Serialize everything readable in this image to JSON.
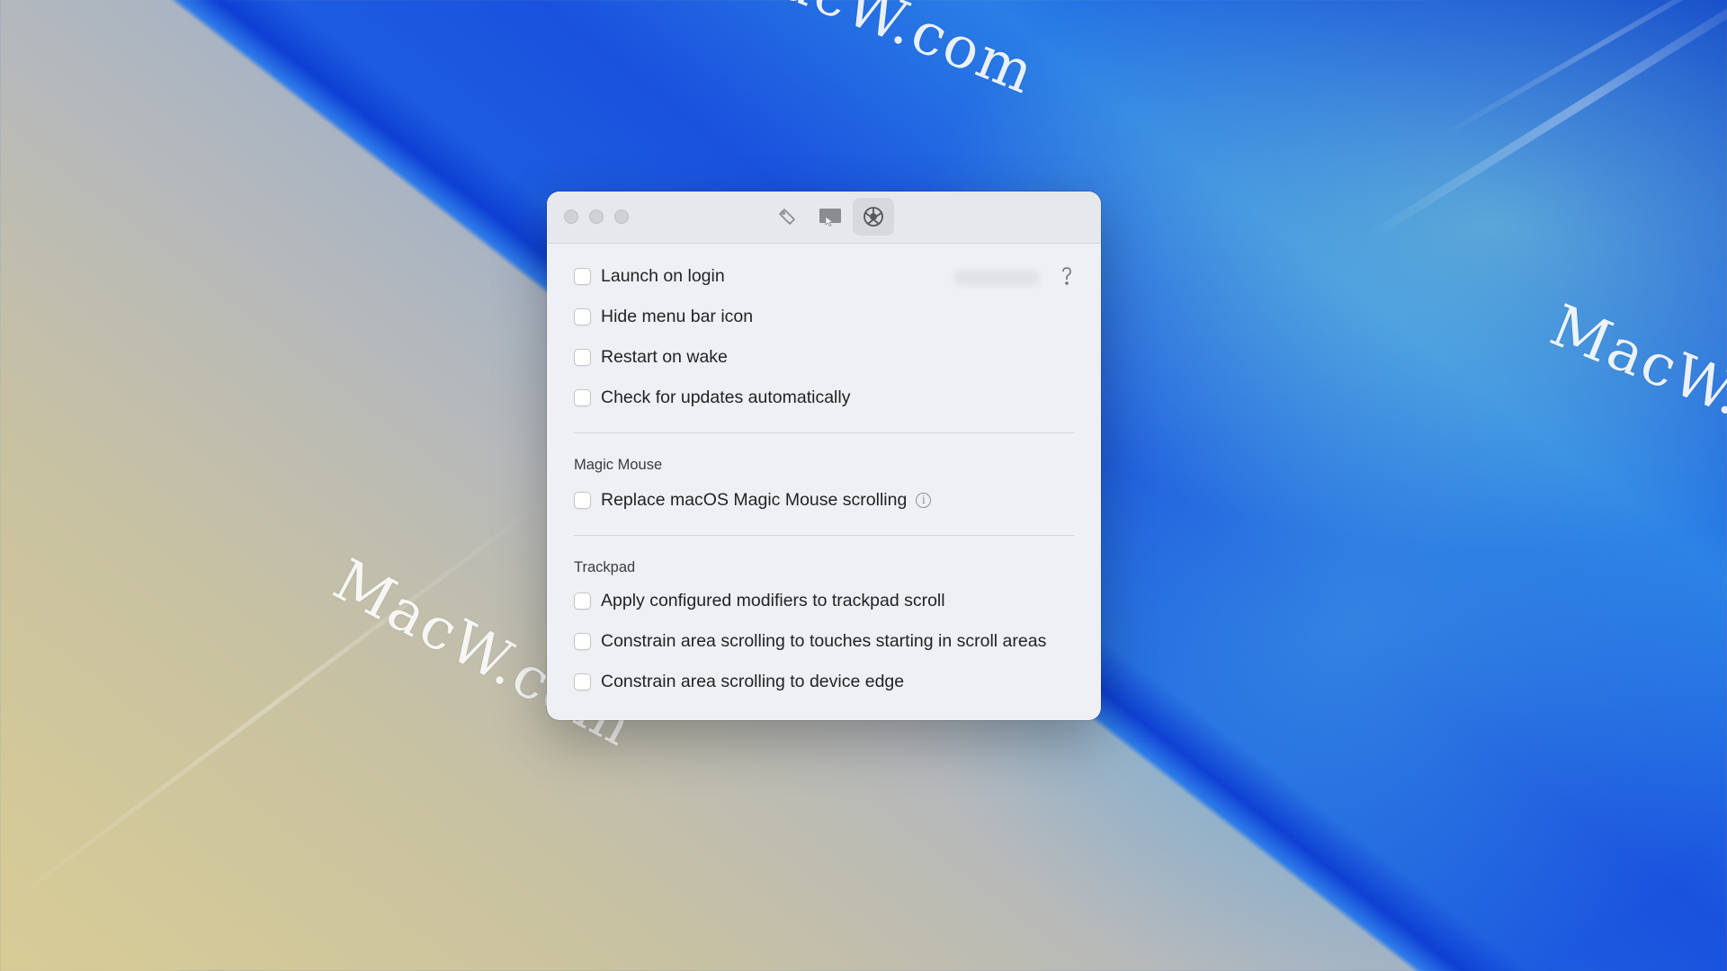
{
  "desktop": {
    "watermarks": [
      "MacW.com",
      "MacW.com",
      "MacW.c"
    ]
  },
  "window": {
    "toolbar": [
      {
        "icon": "tag-icon",
        "active": false
      },
      {
        "icon": "display-icon",
        "active": false
      },
      {
        "icon": "gear-icon",
        "active": true
      }
    ],
    "general": [
      {
        "label": "Launch on login",
        "checked": false
      },
      {
        "label": "Hide menu bar icon",
        "checked": false
      },
      {
        "label": "Restart on wake",
        "checked": false
      },
      {
        "label": "Check for updates automatically",
        "checked": false
      }
    ],
    "magic_mouse": {
      "title": "Magic Mouse",
      "items": [
        {
          "label": "Replace macOS Magic Mouse scrolling",
          "checked": false,
          "info_icon": "info-icon"
        }
      ]
    },
    "trackpad": {
      "title": "Trackpad",
      "items": [
        {
          "label": "Apply configured modifiers to trackpad scroll",
          "checked": false
        },
        {
          "label": "Constrain area scrolling to touches starting in scroll areas",
          "checked": false
        },
        {
          "label": "Constrain area scrolling to device edge",
          "checked": false
        }
      ]
    },
    "help_icon": "question-icon",
    "info_glyph": "i"
  }
}
